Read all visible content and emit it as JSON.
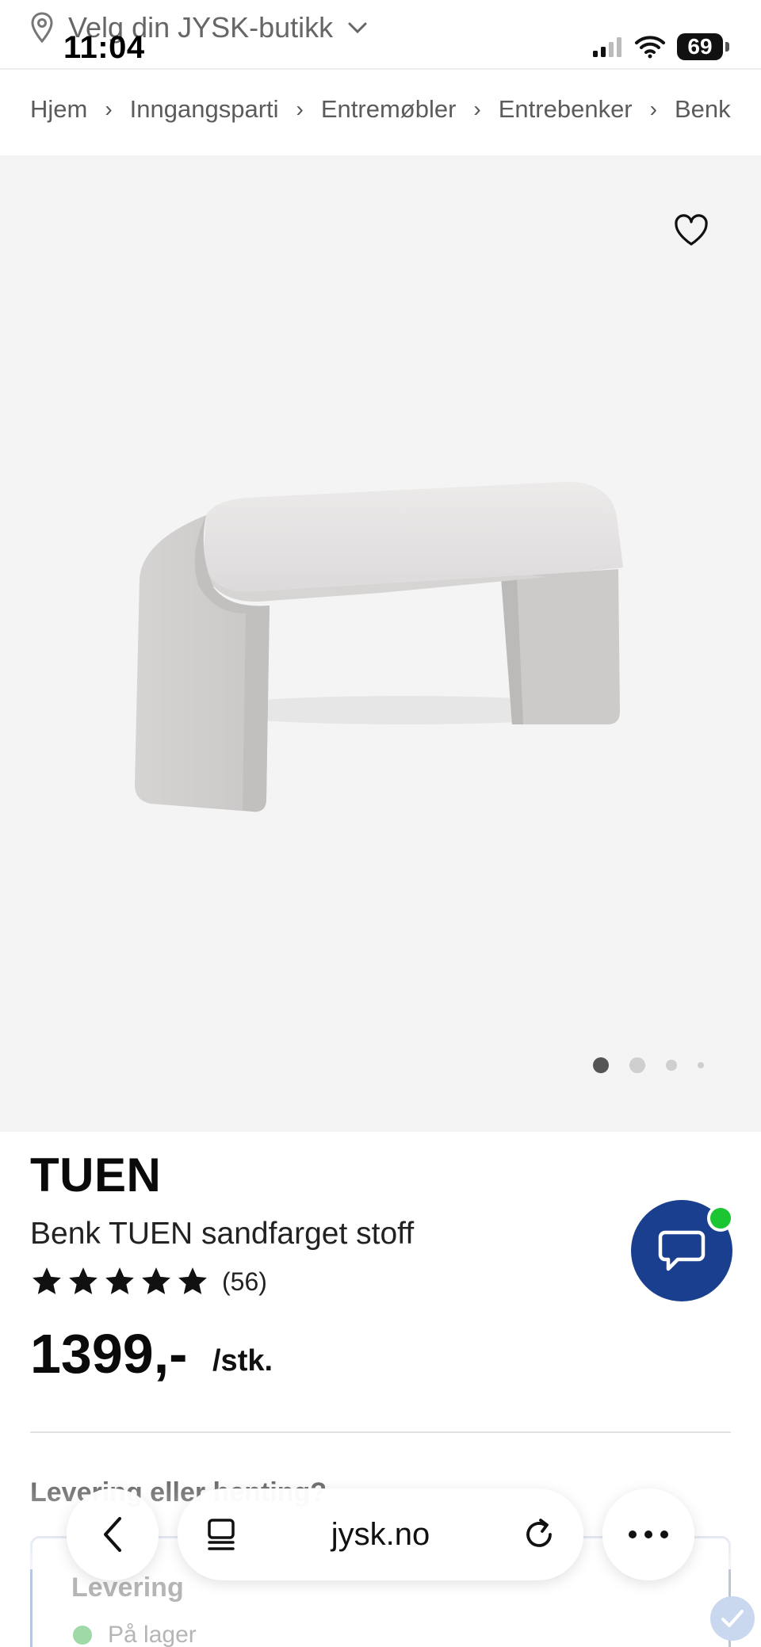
{
  "status_bar": {
    "time": "11:04",
    "battery": "69",
    "icons": [
      "signal-icon",
      "wifi-icon",
      "battery-icon"
    ]
  },
  "store": {
    "label": "Velg din JYSK-butikk",
    "icon": "location-pin-icon"
  },
  "breadcrumb": [
    "Hjem",
    "Inngangsparti",
    "Entremøbler",
    "Entrebenker",
    "Benk"
  ],
  "gallery": {
    "image_count": 4,
    "active_index": 0,
    "favorite_icon": "heart-icon"
  },
  "product": {
    "brand": "TUEN",
    "name": "Benk TUEN sandfarget stoff",
    "rating": 5,
    "rating_count": "(56)",
    "price": "1399,-",
    "unit": "/stk."
  },
  "chat": {
    "icon": "chat-bubble-icon",
    "online_color": "#1cc532",
    "color": "#1b3f8f"
  },
  "delivery": {
    "section_title": "Levering eller henting?",
    "box_title": "Levering",
    "stock": "På lager"
  },
  "browser": {
    "url": "jysk.no"
  },
  "colors": {
    "accent": "#1b3f8f",
    "gallery_bg": "#f4f4f4"
  }
}
